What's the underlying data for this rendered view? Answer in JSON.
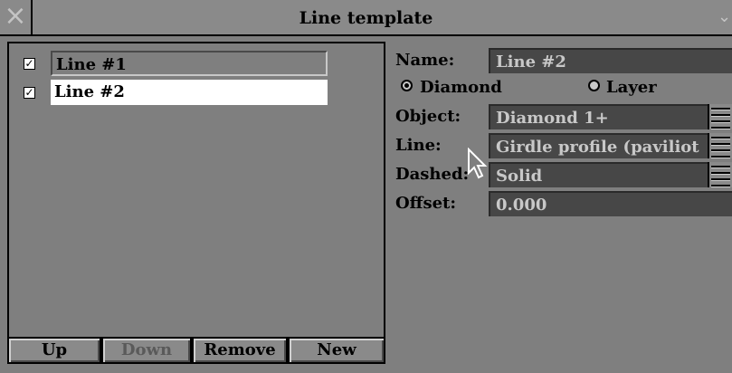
{
  "window": {
    "title": "Line template",
    "close_icon": "close-icon",
    "menu_icon": "chevron-down-icon"
  },
  "lines": [
    {
      "label": "Line #1",
      "checked": true,
      "selected": false
    },
    {
      "label": "Line #2",
      "checked": true,
      "selected": true
    }
  ],
  "buttons": {
    "up": "Up",
    "down": "Down",
    "remove": "Remove",
    "new": "New"
  },
  "form": {
    "name_label": "Name:",
    "name_value": "Line #2",
    "radio_diamond": "Diamond",
    "radio_layer": "Layer",
    "radio_selected": "Diamond",
    "object_label": "Object:",
    "object_value": "Diamond 1+",
    "line_label": "Line:",
    "line_value": "Girdle profile (paviliot",
    "dashed_label": "Dashed:",
    "dashed_value": "Solid",
    "offset_label": "Offset:",
    "offset_value": "0.000"
  },
  "colors": {
    "background": "#7f7f7f",
    "field": "#474747",
    "field_text": "#c8c8c8"
  }
}
